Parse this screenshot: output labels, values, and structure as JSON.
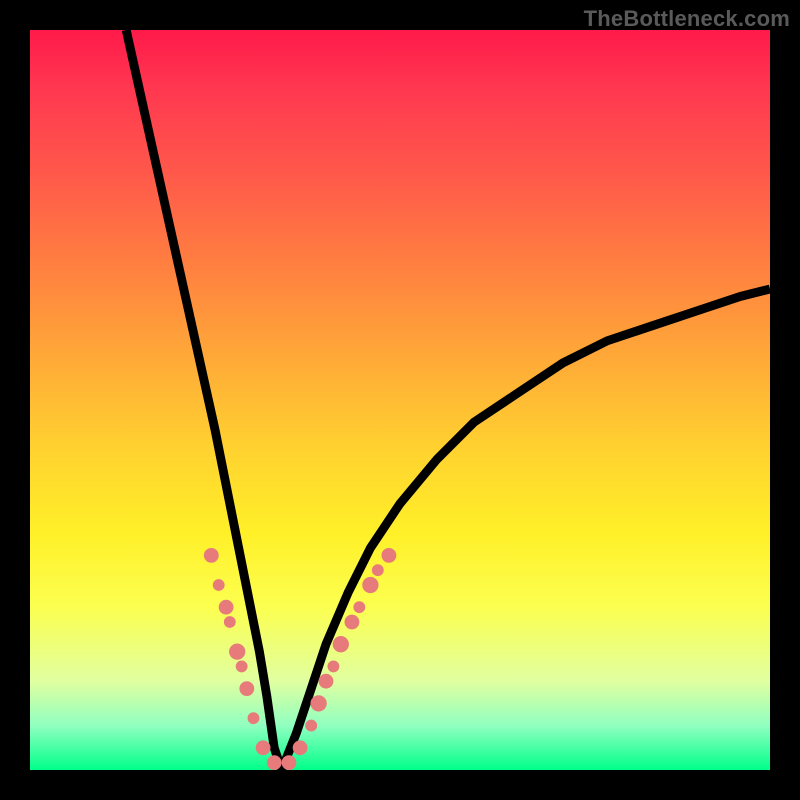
{
  "watermark": "TheBottleneck.com",
  "colors": {
    "background_frame": "#000000",
    "curve": "#000000",
    "marker": "#e77a7a",
    "gradient_top": "#ff1a4a",
    "gradient_bottom": "#00ff8a"
  },
  "chart_data": {
    "type": "line",
    "title": "",
    "xlabel": "",
    "ylabel": "",
    "xlim": [
      0,
      100
    ],
    "ylim": [
      0,
      100
    ],
    "note": "V-shaped bottleneck curve. Left branch descends steeply from near top-left to minimum around x≈34; right branch rises asymptotically toward ~y≈65 at right edge. Salmon markers cluster on both flanks near the trough (roughly y 5–25).",
    "series": [
      {
        "name": "left-branch",
        "x": [
          13,
          15,
          17,
          19,
          21,
          23,
          25,
          26,
          27,
          28,
          29,
          30,
          31,
          32,
          33,
          34
        ],
        "y": [
          100,
          91,
          82,
          73,
          64,
          55,
          46,
          41,
          36,
          31,
          26,
          21,
          16,
          10,
          3,
          0
        ]
      },
      {
        "name": "right-branch",
        "x": [
          34,
          36,
          38,
          40,
          43,
          46,
          50,
          55,
          60,
          66,
          72,
          78,
          84,
          90,
          96,
          100
        ],
        "y": [
          0,
          5,
          11,
          17,
          24,
          30,
          36,
          42,
          47,
          51,
          55,
          58,
          60,
          62,
          64,
          65
        ]
      }
    ],
    "markers": [
      {
        "x": 24.5,
        "y": 29,
        "r": 1.0
      },
      {
        "x": 25.5,
        "y": 25,
        "r": 0.8
      },
      {
        "x": 26.5,
        "y": 22,
        "r": 1.0
      },
      {
        "x": 27.0,
        "y": 20,
        "r": 0.8
      },
      {
        "x": 28.0,
        "y": 16,
        "r": 1.1
      },
      {
        "x": 28.6,
        "y": 14,
        "r": 0.8
      },
      {
        "x": 29.3,
        "y": 11,
        "r": 1.0
      },
      {
        "x": 30.2,
        "y": 7,
        "r": 0.8
      },
      {
        "x": 31.5,
        "y": 3,
        "r": 1.0
      },
      {
        "x": 33.0,
        "y": 1,
        "r": 1.0
      },
      {
        "x": 35.0,
        "y": 1,
        "r": 1.0
      },
      {
        "x": 36.5,
        "y": 3,
        "r": 1.0
      },
      {
        "x": 38.0,
        "y": 6,
        "r": 0.8
      },
      {
        "x": 39.0,
        "y": 9,
        "r": 1.1
      },
      {
        "x": 40.0,
        "y": 12,
        "r": 1.0
      },
      {
        "x": 41.0,
        "y": 14,
        "r": 0.8
      },
      {
        "x": 42.0,
        "y": 17,
        "r": 1.1
      },
      {
        "x": 43.5,
        "y": 20,
        "r": 1.0
      },
      {
        "x": 44.5,
        "y": 22,
        "r": 0.8
      },
      {
        "x": 46.0,
        "y": 25,
        "r": 1.1
      },
      {
        "x": 47.0,
        "y": 27,
        "r": 0.8
      },
      {
        "x": 48.5,
        "y": 29,
        "r": 1.0
      }
    ]
  }
}
